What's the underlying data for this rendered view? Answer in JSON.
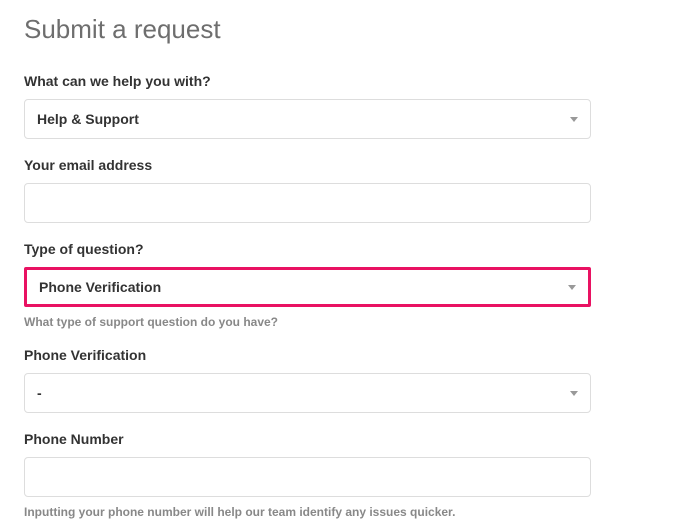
{
  "pageTitle": "Submit a request",
  "fields": {
    "helpWith": {
      "label": "What can we help you with?",
      "value": "Help & Support"
    },
    "email": {
      "label": "Your email address",
      "value": ""
    },
    "questionType": {
      "label": "Type of question?",
      "value": "Phone Verification",
      "help": "What type of support question do you have?"
    },
    "phoneVerification": {
      "label": "Phone Verification",
      "value": "-"
    },
    "phoneNumber": {
      "label": "Phone Number",
      "value": "",
      "help": "Inputting your phone number will help our team identify any issues quicker."
    }
  }
}
